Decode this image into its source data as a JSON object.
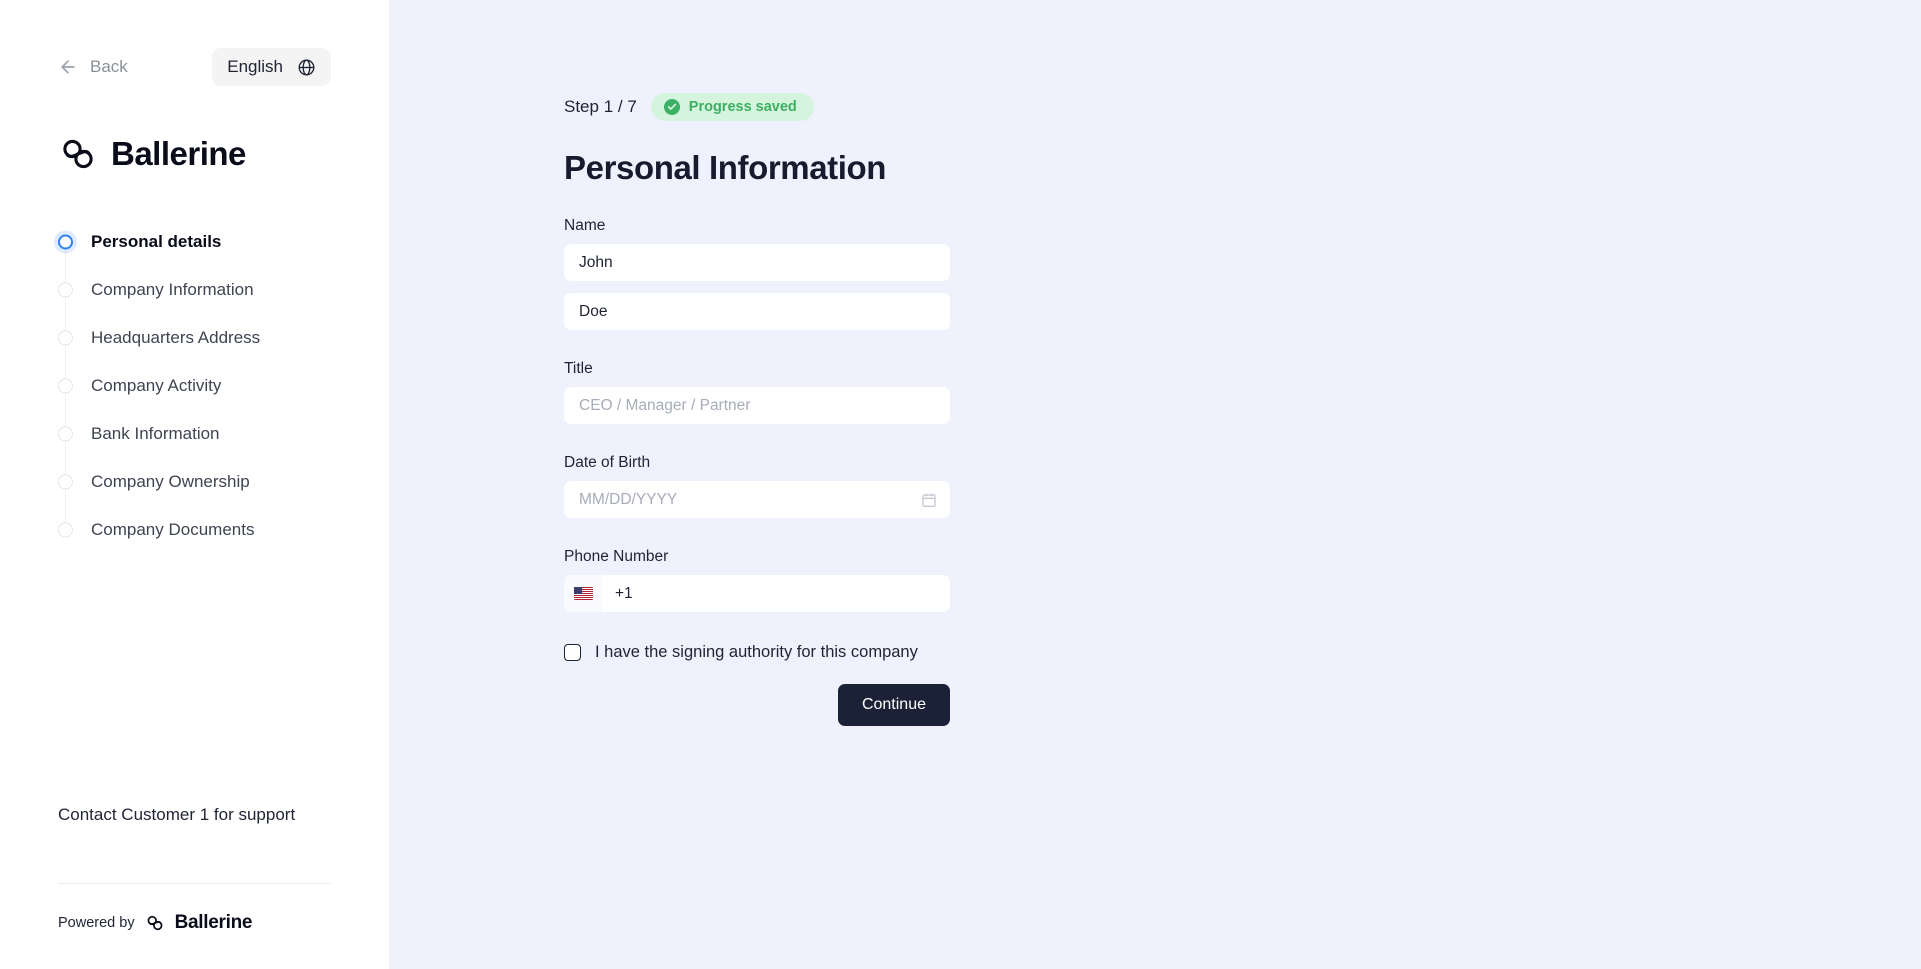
{
  "sidebar": {
    "back_label": "Back",
    "language_label": "English",
    "brand_name": "Ballerine",
    "steps": [
      {
        "label": "Personal details",
        "active": true
      },
      {
        "label": "Company Information",
        "active": false
      },
      {
        "label": "Headquarters Address",
        "active": false
      },
      {
        "label": "Company Activity",
        "active": false
      },
      {
        "label": "Bank Information",
        "active": false
      },
      {
        "label": "Company Ownership",
        "active": false
      },
      {
        "label": "Company Documents",
        "active": false
      }
    ],
    "support_text": "Contact Customer 1 for support",
    "powered_by_label": "Powered by",
    "powered_by_brand": "Ballerine"
  },
  "main": {
    "step_counter": "Step 1 / 7",
    "saved_badge": "Progress saved",
    "title": "Personal Information",
    "fields": {
      "name_label": "Name",
      "first_name_value": "John",
      "last_name_value": "Doe",
      "title_label": "Title",
      "title_placeholder": "CEO / Manager / Partner",
      "dob_label": "Date of Birth",
      "dob_placeholder": "MM/DD/YYYY",
      "phone_label": "Phone Number",
      "phone_value": "+1"
    },
    "checkbox_label": "I have the signing authority for this company",
    "continue_label": "Continue"
  },
  "colors": {
    "accent_blue": "#2f81f7",
    "badge_green_bg": "#d4f4de",
    "badge_green_fg": "#3eaf62",
    "button_dark": "#1b2238",
    "main_bg": "#eff1fd"
  }
}
